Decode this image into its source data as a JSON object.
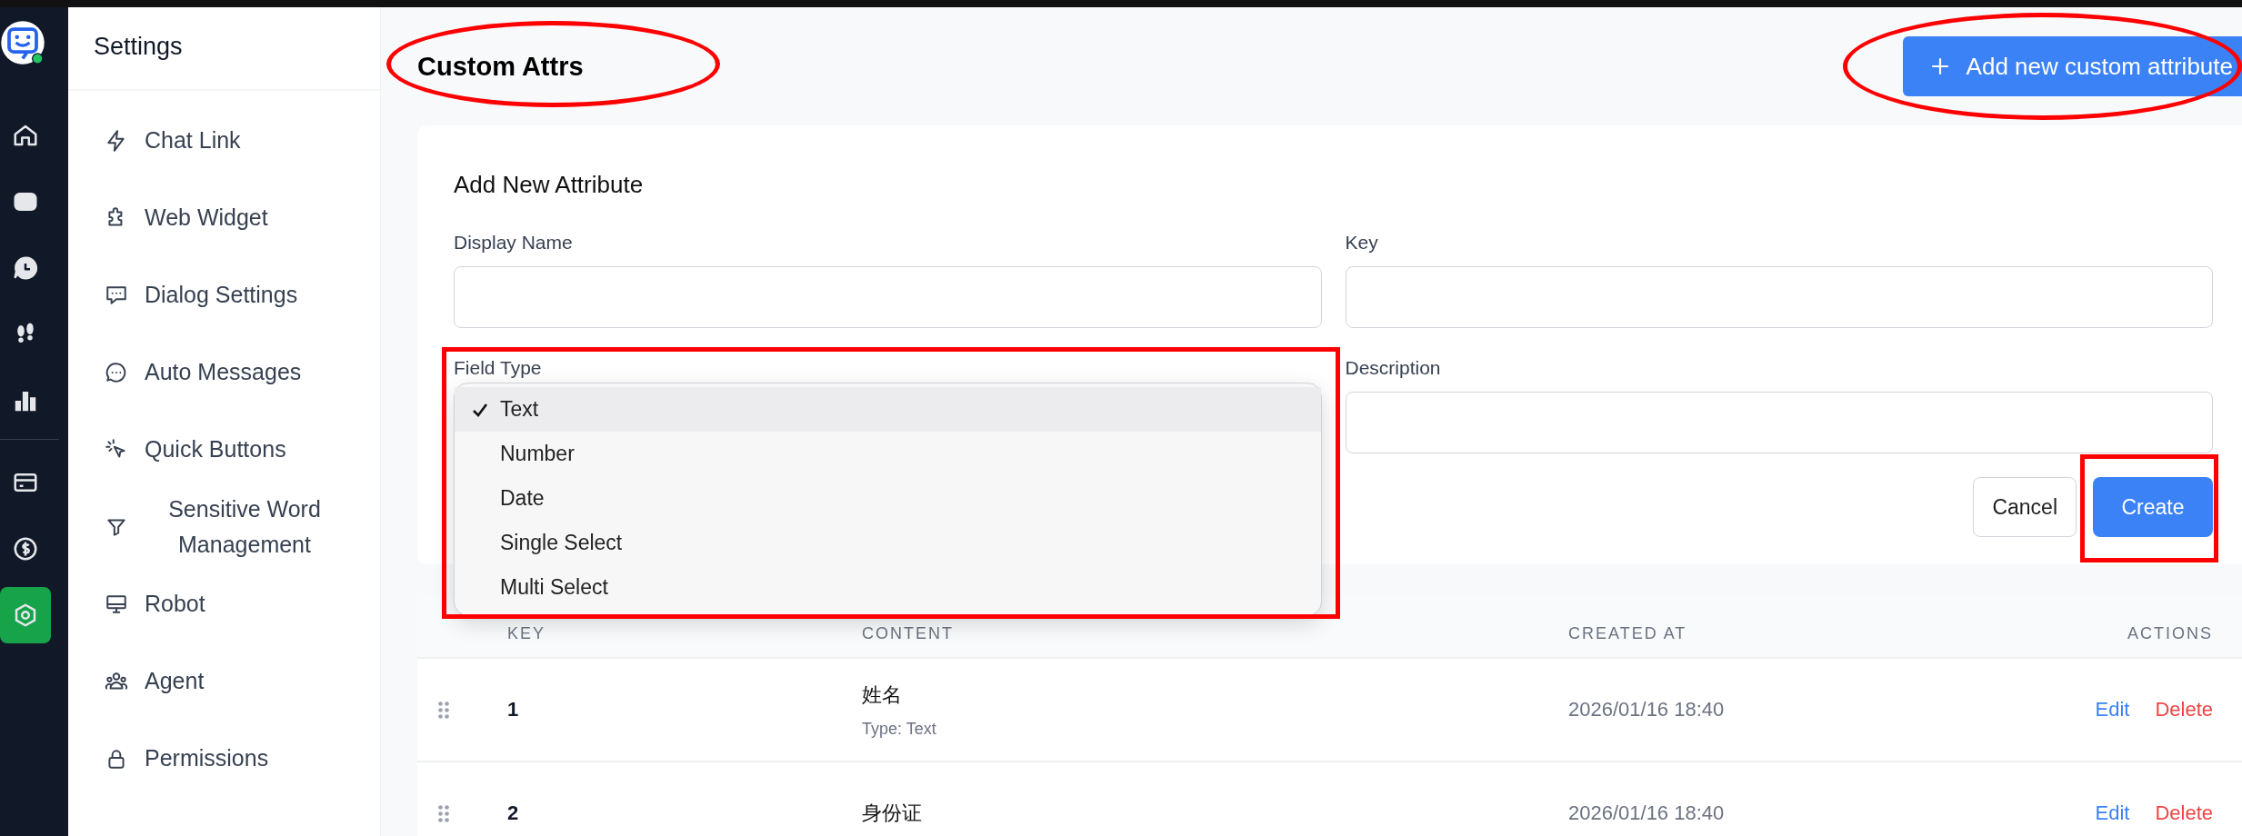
{
  "rail": {
    "items": [
      {
        "selected": false
      },
      {
        "selected": false
      },
      {
        "selected": false
      },
      {
        "selected": false
      },
      {
        "selected": false
      },
      {
        "selected": false
      },
      {
        "selected": false
      },
      {
        "selected": true
      }
    ]
  },
  "sidebar": {
    "title": "Settings",
    "items": [
      {
        "label": "Chat Link"
      },
      {
        "label": "Web Widget"
      },
      {
        "label": "Dialog Settings"
      },
      {
        "label": "Auto Messages"
      },
      {
        "label": "Quick Buttons"
      },
      {
        "label": "Sensitive Word Management"
      },
      {
        "label": "Robot"
      },
      {
        "label": "Agent"
      },
      {
        "label": "Permissions"
      }
    ]
  },
  "header": {
    "title": "Custom Attrs",
    "title_circled": true,
    "add_button": {
      "label": "Add new custom attribute",
      "circled": true
    }
  },
  "form": {
    "title": "Add New Attribute",
    "fields": [
      {
        "label": "Display Name"
      },
      {
        "label": "Key"
      },
      {
        "label": "Field Type",
        "kind": "select"
      },
      {
        "label": "Description"
      }
    ],
    "dropdown": {
      "boxed": true,
      "options": [
        {
          "label": "Text",
          "selected": true
        },
        {
          "label": "Number",
          "selected": false
        },
        {
          "label": "Date",
          "selected": false
        },
        {
          "label": "Single Select",
          "selected": false
        },
        {
          "label": "Multi Select",
          "selected": false
        }
      ]
    },
    "buttons": [
      {
        "label": "Cancel",
        "kind": "secondary",
        "boxed": false
      },
      {
        "label": "Create",
        "kind": "primary",
        "boxed": true
      }
    ]
  },
  "table": {
    "columns": [
      "KEY",
      "CONTENT",
      "CREATED AT",
      "ACTIONS"
    ],
    "rows": [
      {
        "key": "1",
        "content": "姓名",
        "type": "Type: Text",
        "created_at": "2026/01/16 18:40",
        "actions": [
          {
            "label": "Edit",
            "kind": "edit"
          },
          {
            "label": "Delete",
            "kind": "delete"
          }
        ]
      },
      {
        "key": "2",
        "content": "身份证",
        "created_at": "2026/01/16 18:40",
        "actions": [
          {
            "label": "Edit",
            "kind": "edit"
          },
          {
            "label": "Delete",
            "kind": "delete"
          }
        ]
      }
    ]
  }
}
